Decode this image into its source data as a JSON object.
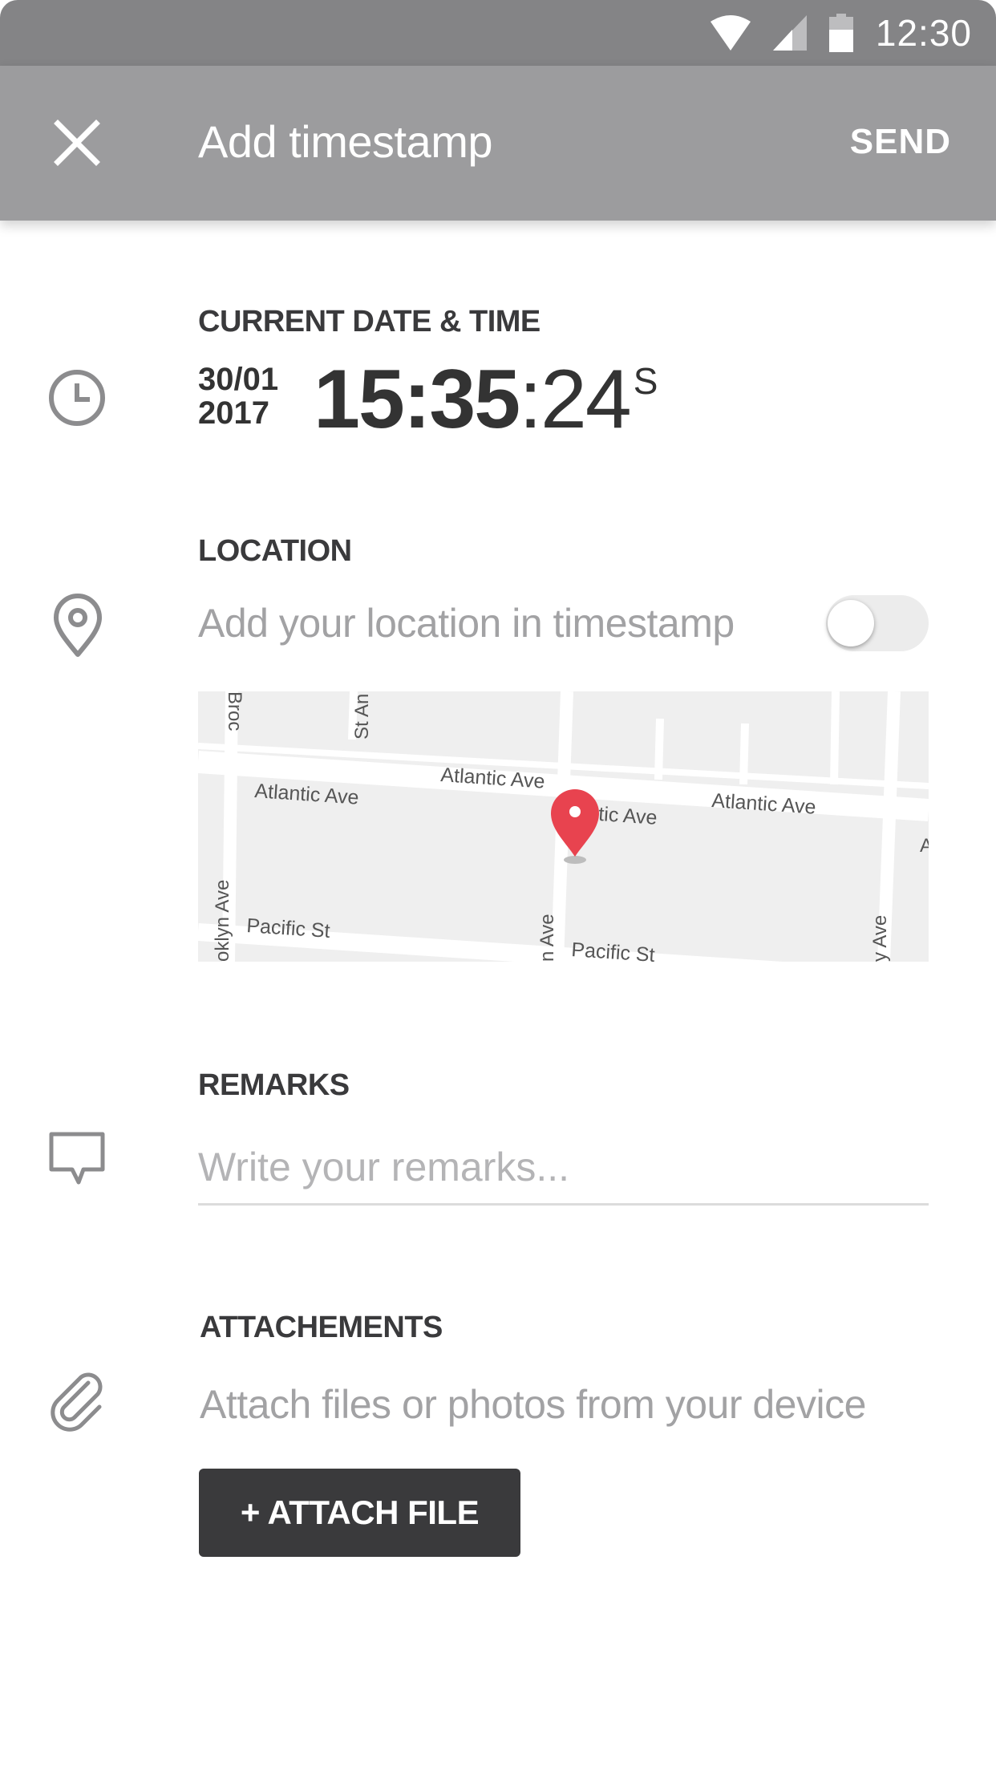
{
  "status_bar": {
    "time": "12:30"
  },
  "app_bar": {
    "title": "Add timestamp",
    "send_label": "SEND"
  },
  "datetime_section": {
    "label": "CURRENT DATE & TIME",
    "date_line1": "30/01",
    "date_line2": "2017",
    "time_hm": "15:35",
    "time_sec": ":24",
    "time_suffix": "S"
  },
  "location_section": {
    "label": "LOCATION",
    "hint": "Add your location in timestamp",
    "toggle_on": false,
    "map_labels": {
      "street_1": "Atlantic Ave",
      "street_2": "Atlantic Ave",
      "street_3": "Atlantic Ave",
      "street_4": "ntic Ave",
      "street_5": "Pacific St",
      "street_6": "Pacific St",
      "street_7": "oklyn Ave",
      "street_8": "Broc",
      "street_9": "St An",
      "street_10": "n Ave",
      "street_11": "y Ave",
      "street_12": "A"
    }
  },
  "remarks_section": {
    "label": "REMARKS",
    "placeholder": "Write your remarks..."
  },
  "attachments_section": {
    "label": "ATTACHEMENTS",
    "hint": "Attach files or photos from your device",
    "button_label": "+ ATTACH FILE"
  },
  "colors": {
    "accent_pin": "#e8434f",
    "button_bg": "#3a3a3c",
    "appbar_bg": "#9c9c9e"
  }
}
